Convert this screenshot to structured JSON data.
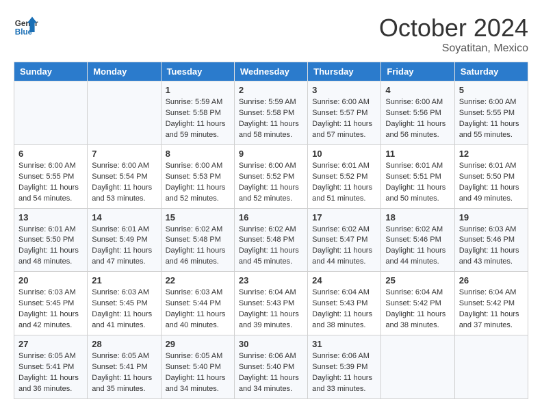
{
  "header": {
    "logo_line1": "General",
    "logo_line2": "Blue",
    "month": "October 2024",
    "location": "Soyatitan, Mexico"
  },
  "days_of_week": [
    "Sunday",
    "Monday",
    "Tuesday",
    "Wednesday",
    "Thursday",
    "Friday",
    "Saturday"
  ],
  "weeks": [
    [
      {
        "day": "",
        "content": ""
      },
      {
        "day": "",
        "content": ""
      },
      {
        "day": "1",
        "content": "Sunrise: 5:59 AM\nSunset: 5:58 PM\nDaylight: 11 hours and 59 minutes."
      },
      {
        "day": "2",
        "content": "Sunrise: 5:59 AM\nSunset: 5:58 PM\nDaylight: 11 hours and 58 minutes."
      },
      {
        "day": "3",
        "content": "Sunrise: 6:00 AM\nSunset: 5:57 PM\nDaylight: 11 hours and 57 minutes."
      },
      {
        "day": "4",
        "content": "Sunrise: 6:00 AM\nSunset: 5:56 PM\nDaylight: 11 hours and 56 minutes."
      },
      {
        "day": "5",
        "content": "Sunrise: 6:00 AM\nSunset: 5:55 PM\nDaylight: 11 hours and 55 minutes."
      }
    ],
    [
      {
        "day": "6",
        "content": "Sunrise: 6:00 AM\nSunset: 5:55 PM\nDaylight: 11 hours and 54 minutes."
      },
      {
        "day": "7",
        "content": "Sunrise: 6:00 AM\nSunset: 5:54 PM\nDaylight: 11 hours and 53 minutes."
      },
      {
        "day": "8",
        "content": "Sunrise: 6:00 AM\nSunset: 5:53 PM\nDaylight: 11 hours and 52 minutes."
      },
      {
        "day": "9",
        "content": "Sunrise: 6:00 AM\nSunset: 5:52 PM\nDaylight: 11 hours and 52 minutes."
      },
      {
        "day": "10",
        "content": "Sunrise: 6:01 AM\nSunset: 5:52 PM\nDaylight: 11 hours and 51 minutes."
      },
      {
        "day": "11",
        "content": "Sunrise: 6:01 AM\nSunset: 5:51 PM\nDaylight: 11 hours and 50 minutes."
      },
      {
        "day": "12",
        "content": "Sunrise: 6:01 AM\nSunset: 5:50 PM\nDaylight: 11 hours and 49 minutes."
      }
    ],
    [
      {
        "day": "13",
        "content": "Sunrise: 6:01 AM\nSunset: 5:50 PM\nDaylight: 11 hours and 48 minutes."
      },
      {
        "day": "14",
        "content": "Sunrise: 6:01 AM\nSunset: 5:49 PM\nDaylight: 11 hours and 47 minutes."
      },
      {
        "day": "15",
        "content": "Sunrise: 6:02 AM\nSunset: 5:48 PM\nDaylight: 11 hours and 46 minutes."
      },
      {
        "day": "16",
        "content": "Sunrise: 6:02 AM\nSunset: 5:48 PM\nDaylight: 11 hours and 45 minutes."
      },
      {
        "day": "17",
        "content": "Sunrise: 6:02 AM\nSunset: 5:47 PM\nDaylight: 11 hours and 44 minutes."
      },
      {
        "day": "18",
        "content": "Sunrise: 6:02 AM\nSunset: 5:46 PM\nDaylight: 11 hours and 44 minutes."
      },
      {
        "day": "19",
        "content": "Sunrise: 6:03 AM\nSunset: 5:46 PM\nDaylight: 11 hours and 43 minutes."
      }
    ],
    [
      {
        "day": "20",
        "content": "Sunrise: 6:03 AM\nSunset: 5:45 PM\nDaylight: 11 hours and 42 minutes."
      },
      {
        "day": "21",
        "content": "Sunrise: 6:03 AM\nSunset: 5:45 PM\nDaylight: 11 hours and 41 minutes."
      },
      {
        "day": "22",
        "content": "Sunrise: 6:03 AM\nSunset: 5:44 PM\nDaylight: 11 hours and 40 minutes."
      },
      {
        "day": "23",
        "content": "Sunrise: 6:04 AM\nSunset: 5:43 PM\nDaylight: 11 hours and 39 minutes."
      },
      {
        "day": "24",
        "content": "Sunrise: 6:04 AM\nSunset: 5:43 PM\nDaylight: 11 hours and 38 minutes."
      },
      {
        "day": "25",
        "content": "Sunrise: 6:04 AM\nSunset: 5:42 PM\nDaylight: 11 hours and 38 minutes."
      },
      {
        "day": "26",
        "content": "Sunrise: 6:04 AM\nSunset: 5:42 PM\nDaylight: 11 hours and 37 minutes."
      }
    ],
    [
      {
        "day": "27",
        "content": "Sunrise: 6:05 AM\nSunset: 5:41 PM\nDaylight: 11 hours and 36 minutes."
      },
      {
        "day": "28",
        "content": "Sunrise: 6:05 AM\nSunset: 5:41 PM\nDaylight: 11 hours and 35 minutes."
      },
      {
        "day": "29",
        "content": "Sunrise: 6:05 AM\nSunset: 5:40 PM\nDaylight: 11 hours and 34 minutes."
      },
      {
        "day": "30",
        "content": "Sunrise: 6:06 AM\nSunset: 5:40 PM\nDaylight: 11 hours and 34 minutes."
      },
      {
        "day": "31",
        "content": "Sunrise: 6:06 AM\nSunset: 5:39 PM\nDaylight: 11 hours and 33 minutes."
      },
      {
        "day": "",
        "content": ""
      },
      {
        "day": "",
        "content": ""
      }
    ]
  ]
}
